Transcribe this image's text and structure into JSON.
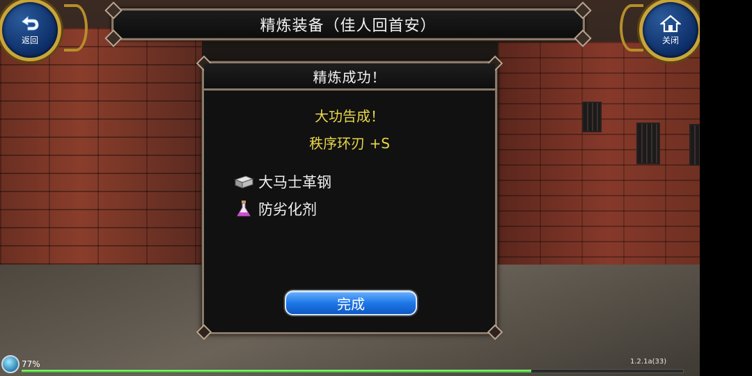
{
  "header": {
    "title": "精炼装备（佳人回首安）"
  },
  "back_button": {
    "label": "返回",
    "icon": "back-arrow-icon"
  },
  "close_button": {
    "label": "关闭",
    "icon": "home-icon"
  },
  "dialog": {
    "title": "精炼成功！",
    "success_line": "大功告成！",
    "result_item": "秩序环刃 +S",
    "materials": [
      {
        "name": "大马士革钢",
        "icon": "steel-ingot-icon"
      },
      {
        "name": "防劣化剂",
        "icon": "potion-flask-icon"
      }
    ],
    "done_label": "完成"
  },
  "status": {
    "percent": "77%",
    "xp_fraction": 0.77,
    "version": "1.2.1a(33)"
  },
  "colors": {
    "accent_gold": "#c9a43a",
    "success_text": "#e9d74a",
    "button_blue": "#1f78e8"
  }
}
